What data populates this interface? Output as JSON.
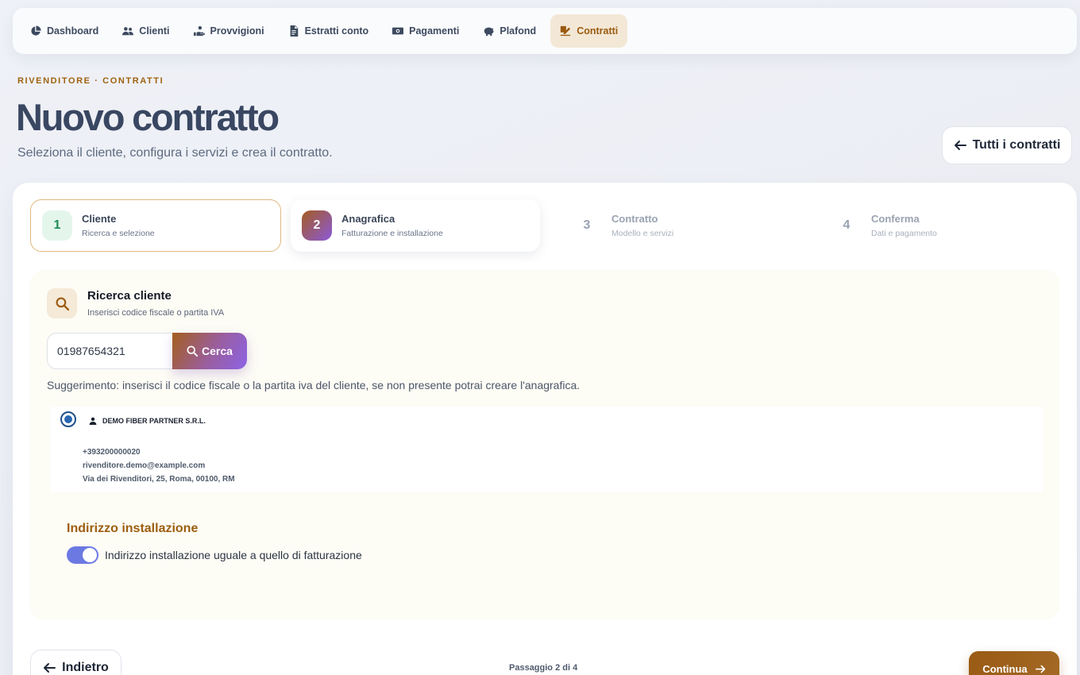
{
  "nav": {
    "items": [
      {
        "label": "Dashboard",
        "icon": "pie-chart-icon"
      },
      {
        "label": "Clienti",
        "icon": "users-icon"
      },
      {
        "label": "Provvigioni",
        "icon": "hand-coin-icon"
      },
      {
        "label": "Estratti conto",
        "icon": "document-icon"
      },
      {
        "label": "Pagamenti",
        "icon": "money-icon"
      },
      {
        "label": "Plafond",
        "icon": "piggy-bank-icon"
      },
      {
        "label": "Contratti",
        "icon": "signature-icon",
        "active": true
      }
    ]
  },
  "header": {
    "eyebrow": "RIVENDITORE · CONTRATTI",
    "title": "Nuovo contratto",
    "subtitle": "Seleziona il cliente, configura i servizi e crea il contratto.",
    "all_contracts_label": "Tutti i contratti"
  },
  "steps": [
    {
      "num": "1",
      "title": "Cliente",
      "desc": "Ricerca e selezione"
    },
    {
      "num": "2",
      "title": "Anagrafica",
      "desc": "Fatturazione e installazione"
    },
    {
      "num": "3",
      "title": "Contratto",
      "desc": "Modello e servizi"
    },
    {
      "num": "4",
      "title": "Conferma",
      "desc": "Dati e pagamento"
    }
  ],
  "search": {
    "title": "Ricerca cliente",
    "subtitle": "Inserisci codice fiscale o partita IVA",
    "value": "01987654321",
    "button_label": "Cerca",
    "hint": "Suggerimento: inserisci il codice fiscale o la partita iva del cliente, se non presente potrai creare l'anagrafica."
  },
  "client": {
    "name": "DEMO FIBER PARTNER S.R.L.",
    "phone": "+393200000020",
    "email": "rivenditore.demo@example.com",
    "address": "Via dei Rivenditori, 25, Roma, 00100, RM",
    "selected": true
  },
  "install": {
    "title": "Indirizzo installazione",
    "toggle_label": "Indirizzo installazione uguale a quello di fatturazione",
    "toggle_on": true
  },
  "footer": {
    "back_label": "Indietro",
    "step_counter": "Passaggio 2 di 4",
    "next_label": "Continua"
  },
  "colors": {
    "accent": "#9a5b10",
    "toggle": "#6c79e2",
    "step_done_bg": "#e4f6ec"
  }
}
